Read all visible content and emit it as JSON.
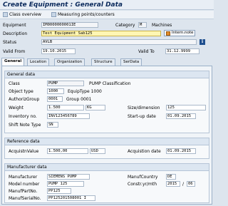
{
  "window": {
    "title": "Create Equipment : General Data"
  },
  "toolbar": {
    "class_overview": "Class overview",
    "measuring_points": "Measuring points/counters"
  },
  "header": {
    "equipment_label": "Equipment",
    "equipment_value": "IM0000000001IE",
    "category_label": "Category",
    "category_value": "M",
    "category_text": "Machines",
    "description_label": "Description",
    "description_value": "Test Equipment Sab125",
    "intern_note": "Intern.note",
    "status_label": "Status",
    "status_value": "AVLB",
    "valid_from_label": "Valid From",
    "valid_from_value": "19.10.2015",
    "valid_to_label": "Valid To",
    "valid_to_value": "31.12.9999",
    "info_icon_text": "i"
  },
  "tabs": [
    {
      "label": "General"
    },
    {
      "label": "Location"
    },
    {
      "label": "Organization"
    },
    {
      "label": "Structure"
    },
    {
      "label": "SerData"
    }
  ],
  "general_data": {
    "title": "General data",
    "class_label": "Class",
    "class_value": "PUMP",
    "class_text": "PUMP Classification",
    "object_type_label": "Object type",
    "object_type_value": "1000",
    "object_type_text": "EquipType 1000",
    "auth_group_label": "AuthorizGroup",
    "auth_group_value": "0001",
    "auth_group_text": "Group 0001",
    "weight_label": "Weight",
    "weight_value": "1.500",
    "weight_unit": "KG",
    "size_label": "Size/dimension",
    "size_value": "125",
    "inventory_label": "Inventory no.",
    "inventory_value": "INV123456789",
    "startup_label": "Start-up date",
    "startup_value": "01.09.2015",
    "shift_label": "Shift Note Type",
    "shift_value": "SN"
  },
  "reference_data": {
    "title": "Reference data",
    "acq_value_label": "AcquistnValue",
    "acq_value_value": "1.500,00",
    "acq_value_currency": "USD",
    "acq_date_label": "Acquistion date",
    "acq_date_value": "01.09.2015"
  },
  "manufacturer_data": {
    "title": "Manufacturer data",
    "manufacturer_label": "Manufacturer",
    "manufacturer_value": "SIEMENS PUMP",
    "country_label": "ManufCountry",
    "country_value": "DE",
    "model_label": "Model number",
    "model_value": "PUMP 125",
    "constr_label": "Constr.yr/mth",
    "constr_year": "2015",
    "constr_sep": "/",
    "constr_month": "06",
    "part_label": "ManufPartNo.",
    "part_value": "PP125",
    "serial_label": "ManufSerialNo.",
    "serial_value": "PP125201508001 I",
    "sap_icon_text": "i"
  }
}
